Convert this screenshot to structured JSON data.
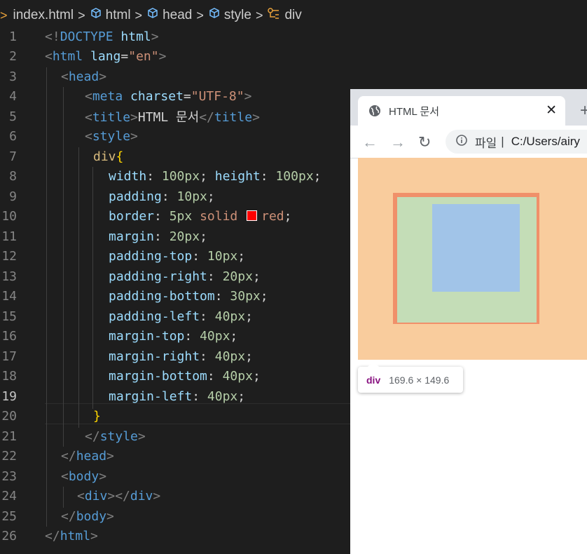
{
  "breadcrumb": {
    "lead": ">",
    "file": "index.html",
    "items": [
      "html",
      "head",
      "style",
      "div"
    ],
    "sep": ">"
  },
  "editor": {
    "line_numbers": [
      "1",
      "2",
      "3",
      "4",
      "5",
      "6",
      "7",
      "8",
      "9",
      "10",
      "11",
      "12",
      "13",
      "14",
      "15",
      "16",
      "17",
      "18",
      "19",
      "20",
      "21",
      "22",
      "23",
      "24",
      "25",
      "26"
    ],
    "current_line": "19",
    "code": {
      "doctype": {
        "open": "<!",
        "kw": "DOCTYPE",
        "name": "html",
        "close": ">"
      },
      "html_open": {
        "lt": "<",
        "tag": "html",
        "attr": "lang",
        "eq": "=",
        "val": "\"en\"",
        "gt": ">"
      },
      "head_open": {
        "lt": "<",
        "tag": "head",
        "gt": ">"
      },
      "meta": {
        "lt": "<",
        "tag": "meta",
        "attr": "charset",
        "eq": "=",
        "val": "\"UTF-8\"",
        "gt": ">"
      },
      "title": {
        "lt": "<",
        "tag": "title",
        "gt": ">",
        "text": "HTML 문서",
        "lt2": "</",
        "tag2": "title",
        "gt2": ">"
      },
      "style_open": {
        "lt": "<",
        "tag": "style",
        "gt": ">"
      },
      "selector": "div",
      "brace_open": "{",
      "brace_close": "}",
      "decl": [
        {
          "prop": "width",
          "val": "100px",
          "prop2": "height",
          "val2": "100px"
        },
        {
          "prop": "padding",
          "val": "10px"
        },
        {
          "prop": "border",
          "val": "5px",
          "kw": "solid",
          "color": "red"
        },
        {
          "prop": "margin",
          "val": "20px"
        },
        {
          "prop": "padding-top",
          "val": "10px"
        },
        {
          "prop": "padding-right",
          "val": "20px"
        },
        {
          "prop": "padding-bottom",
          "val": "30px"
        },
        {
          "prop": "padding-left",
          "val": "40px"
        },
        {
          "prop": "margin-top",
          "val": "40px"
        },
        {
          "prop": "margin-right",
          "val": "40px"
        },
        {
          "prop": "margin-bottom",
          "val": "40px"
        },
        {
          "prop": "margin-left",
          "val": "40px"
        }
      ],
      "style_close": {
        "lt": "</",
        "tag": "style",
        "gt": ">"
      },
      "head_close": {
        "lt": "</",
        "tag": "head",
        "gt": ">"
      },
      "body_open": {
        "lt": "<",
        "tag": "body",
        "gt": ">"
      },
      "div": {
        "lt": "<",
        "tag": "div",
        "gt": "></",
        "tag2": "div",
        "gt2": ">"
      },
      "body_close": {
        "lt": "</",
        "tag": "body",
        "gt": ">"
      },
      "html_close": {
        "lt": "</",
        "tag": "html",
        "gt": ">"
      }
    },
    "swatch_color": "#ff0000"
  },
  "browser": {
    "tab_title": "HTML 문서",
    "close_glyph": "✕",
    "newtab_glyph": "+",
    "back_glyph": "←",
    "forward_glyph": "→",
    "reload_glyph": "↻",
    "address_label": "파일",
    "address_sep": "|",
    "address_url": "C:/Users/airy",
    "tooltip_name": "div",
    "tooltip_size": "169.6 × 149.6"
  },
  "colors": {
    "margin": "#f9cc9d",
    "border": "#f0906a",
    "padding": "#c4ddb7",
    "content": "#a1c4e8"
  }
}
